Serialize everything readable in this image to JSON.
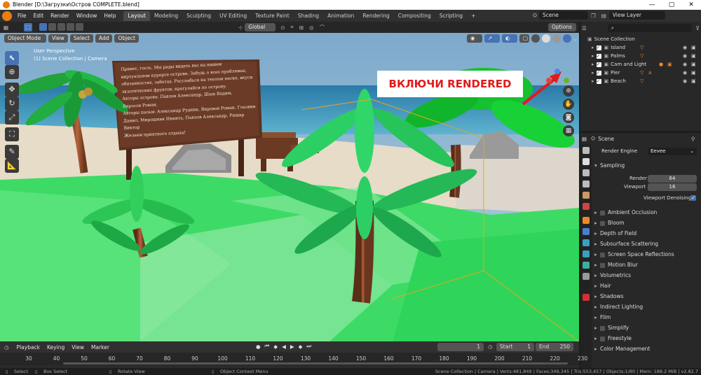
{
  "window": {
    "title": "Blender [D:\\Загрузки\\Остров COMPLETE.blend]",
    "controls": [
      "—",
      "▢",
      "✕"
    ]
  },
  "menu": [
    "File",
    "Edit",
    "Render",
    "Window",
    "Help"
  ],
  "workspaces": [
    "Layout",
    "Modeling",
    "Sculpting",
    "UV Editing",
    "Texture Paint",
    "Shading",
    "Animation",
    "Rendering",
    "Compositing",
    "Scripting",
    "+"
  ],
  "active_workspace": "Layout",
  "scene_name": "Scene",
  "view_layer": "View Layer",
  "viewport_header": {
    "mode": "Object Mode",
    "view": "View",
    "select": "Select",
    "add": "Add",
    "object": "Object",
    "orientation": "Global",
    "options": "Options"
  },
  "viewport": {
    "perspective": "User Perspective",
    "collection": "(1) Scene Collection | Camera"
  },
  "annotation": "ВКЛЮЧИ RENDERED",
  "sign_text": [
    "Привет, гость. Мы рады видеть вас на нашем",
    "виртуальном курорте острове. Забудь о всех проблемах,",
    "обязанностях, заботах. Расслабься на теплом песке, вкуси",
    "экзотических фруктов, прогуляйся по острову.",
    "Авторы острова: Павлов Александр, Шаш Вадим,",
    "Виросов Роман.",
    "Авторы пальм: Александр Рудник, Вировов Роман, Глазвин",
    "Данил, Мирошник Никита, Павлов Александр, Ришар Виктор",
    "Желаем приятного отдыха!"
  ],
  "outliner": {
    "root": "Scene Collection",
    "items": [
      {
        "name": "Island",
        "icon": "#e8892b"
      },
      {
        "name": "Palms",
        "icon": "#e8892b"
      },
      {
        "name": "Cam and Light",
        "icon": "#e8892b"
      },
      {
        "name": "Pier",
        "icon": "#e8892b"
      },
      {
        "name": "Beach",
        "icon": "#e8892b"
      }
    ]
  },
  "properties": {
    "context": "Scene",
    "render_engine_label": "Render Engine",
    "render_engine": "Eevee",
    "sampling": {
      "label": "Sampling",
      "render_label": "Render",
      "render": "64",
      "viewport_label": "Viewport",
      "viewport": "16",
      "denoise_label": "Viewport Denoising"
    },
    "sections": [
      {
        "label": "Ambient Occlusion",
        "checkbox": true
      },
      {
        "label": "Bloom",
        "checkbox": true
      },
      {
        "label": "Depth of Field",
        "checkbox": false
      },
      {
        "label": "Subsurface Scattering",
        "checkbox": false
      },
      {
        "label": "Screen Space Reflections",
        "checkbox": true
      },
      {
        "label": "Motion Blur",
        "checkbox": true
      },
      {
        "label": "Volumetrics",
        "checkbox": false
      },
      {
        "label": "Hair",
        "checkbox": false
      },
      {
        "label": "Shadows",
        "checkbox": false
      },
      {
        "label": "Indirect Lighting",
        "checkbox": false
      },
      {
        "label": "Film",
        "checkbox": false
      },
      {
        "label": "Simplify",
        "checkbox": true
      },
      {
        "label": "Freestyle",
        "checkbox": true
      },
      {
        "label": "Color Management",
        "checkbox": false
      }
    ]
  },
  "timeline": {
    "playback": "Playback",
    "keying": "Keying",
    "view": "View",
    "marker": "Marker",
    "current_frame": "1",
    "start_label": "Start",
    "start": "1",
    "end_label": "End",
    "end": "250",
    "ticks": [
      "30",
      "40",
      "50",
      "60",
      "70",
      "80",
      "90",
      "100",
      "110",
      "120",
      "130",
      "140",
      "150",
      "160",
      "170",
      "180",
      "190",
      "200",
      "210",
      "220",
      "230"
    ]
  },
  "statusbar": {
    "select": "Select",
    "box_select": "Box Select",
    "rotate": "Rotate View",
    "context": "Object Context Menu",
    "stats": "Scene Collection | Camera | Verts:481,849 | Faces:349,345 | Tris:553,457 | Objects:1/80 | Mem: 188.2 MiB | v2.82.7"
  }
}
